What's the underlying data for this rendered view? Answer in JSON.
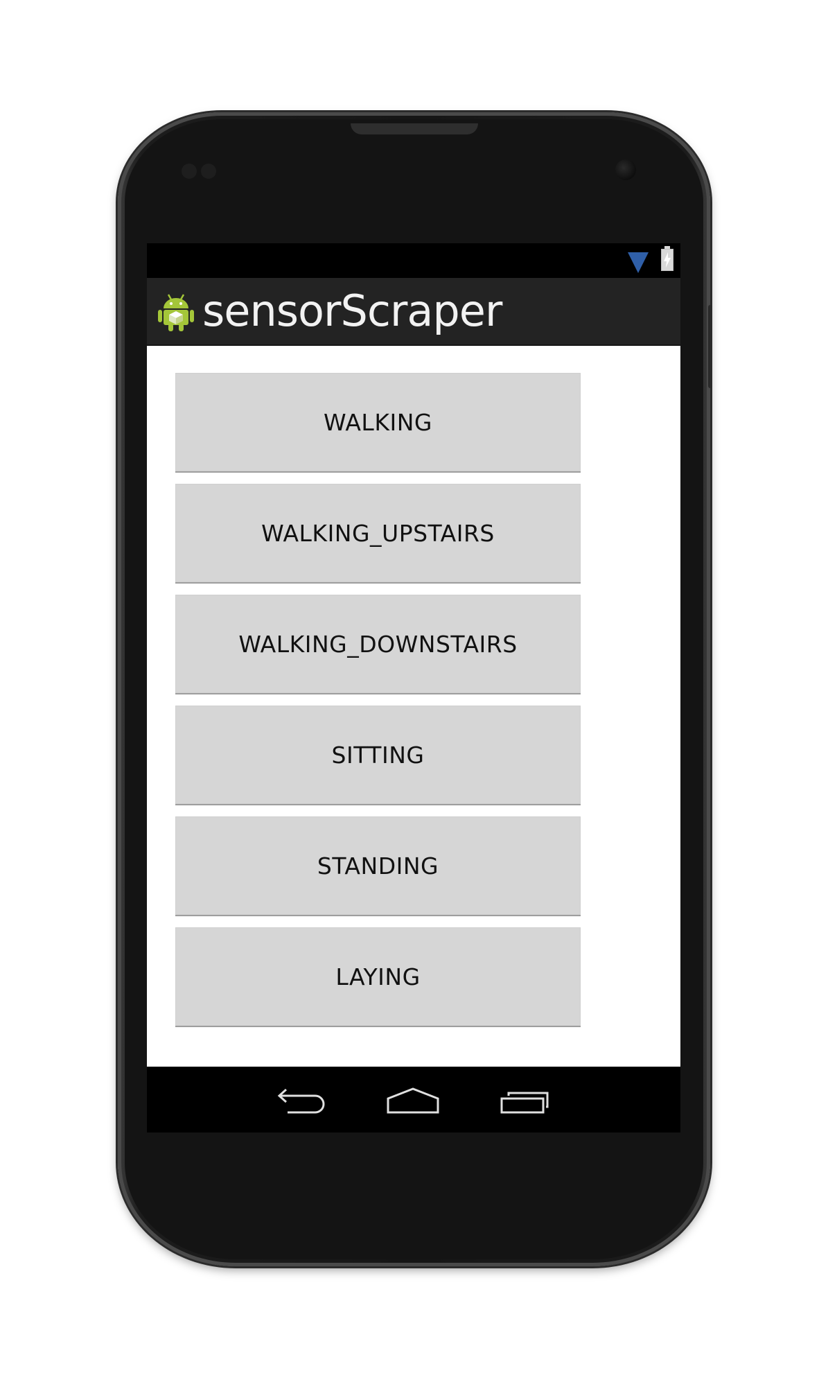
{
  "app": {
    "title": "sensorScraper"
  },
  "status_bar": {
    "icons": [
      "wifi-signal-icon",
      "battery-charging-icon"
    ]
  },
  "buttons": [
    {
      "label": "WALKING"
    },
    {
      "label": "WALKING_UPSTAIRS"
    },
    {
      "label": "WALKING_DOWNSTAIRS"
    },
    {
      "label": "SITTING"
    },
    {
      "label": "STANDING"
    },
    {
      "label": "LAYING"
    }
  ],
  "nav_bar": {
    "icons": [
      "back-icon",
      "home-icon",
      "recent-apps-icon"
    ]
  },
  "colors": {
    "action_bar": "#232323",
    "button_bg": "#d6d6d6",
    "wifi": "#2f5fa8",
    "screen_bg": "#ffffff"
  }
}
